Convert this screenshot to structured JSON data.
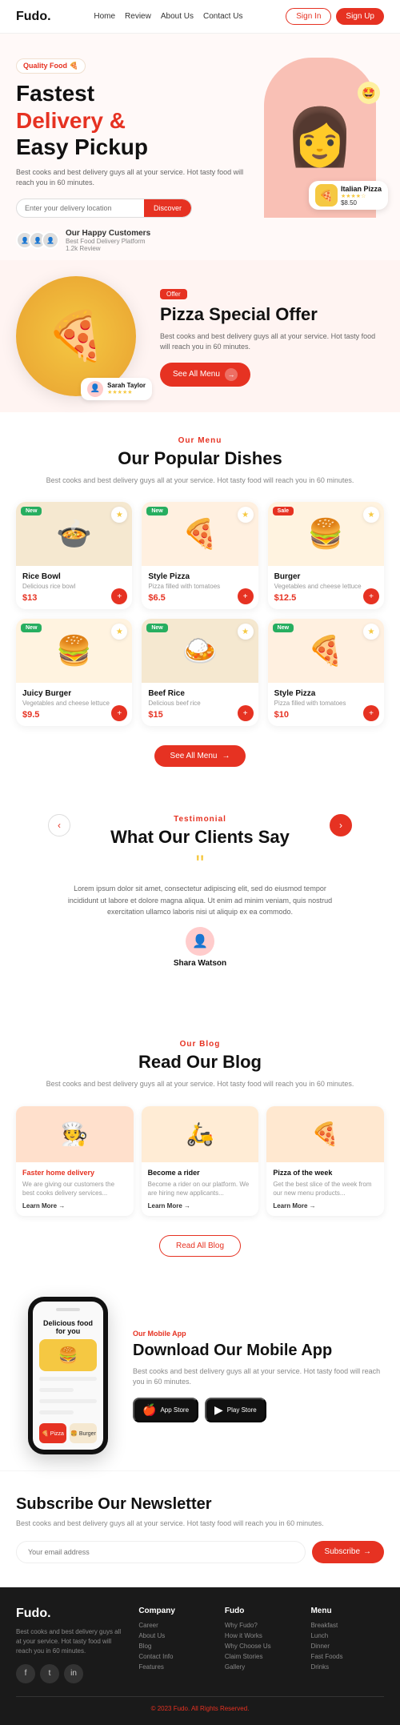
{
  "brand": "Fudo.",
  "nav": {
    "links": [
      "Home",
      "Review",
      "About Us",
      "Contact Us"
    ],
    "signin": "Sign In",
    "signup": "Sign Up"
  },
  "hero": {
    "badge": "Quality Food 🍕",
    "title_line1": "Fastest",
    "title_line2": "Delivery &",
    "title_line3": "Easy Pickup",
    "desc": "Best cooks and best delivery guys all at your service. Hot tasty food will reach you in 60 minutes.",
    "search_placeholder": "Enter your delivery location",
    "search_btn": "Discover",
    "customers": {
      "label": "Our Happy Customers",
      "sub": "Best Food Delivery Platform",
      "review_count": "1.2k Review"
    },
    "pizza_name": "Italian Pizza",
    "pizza_price": "$8.50",
    "emoji": "🤩"
  },
  "special_offer": {
    "tag": "Offer",
    "title": "Pizza Special Offer",
    "desc": "Best cooks and best delivery guys all at your service. Hot tasty food will reach you in 60 minutes.",
    "see_all": "See All Menu",
    "reviewer_name": "Sarah Taylor"
  },
  "popular": {
    "label": "Our Menu",
    "title": "Our Popular Dishes",
    "desc": "Best cooks and best delivery guys all at your service.\nHot tasty food will reach you in 60 minutes.",
    "see_all": "See All Menu",
    "dishes": [
      {
        "name": "Rice Bowl",
        "sub": "Delicious rice bowl",
        "price": "$13",
        "badge": "New",
        "emoji": "🍲",
        "bg": "rice"
      },
      {
        "name": "Style Pizza",
        "sub": "Pizza filled with tomatoes",
        "price": "$6.5",
        "badge": "New",
        "emoji": "🍕",
        "bg": "pizza"
      },
      {
        "name": "Burger",
        "sub": "Vegetables and cheese lettuce",
        "price": "$12.5",
        "badge": "Sale",
        "emoji": "🍔",
        "bg": "burger"
      },
      {
        "name": "Juicy Burger",
        "sub": "Vegetables and cheese lettuce",
        "price": "$9.5",
        "badge": "New",
        "emoji": "🍔",
        "bg": "burger"
      },
      {
        "name": "Beef Rice",
        "sub": "Delicious beef rice",
        "price": "$15",
        "badge": "New",
        "emoji": "🍛",
        "bg": "rice"
      },
      {
        "name": "Style Pizza",
        "sub": "Pizza filled with tomatoes",
        "price": "$10",
        "badge": "New",
        "emoji": "🍕",
        "bg": "pizza"
      }
    ]
  },
  "testimonials": {
    "label": "Testimonial",
    "title": "What Our Clients Say",
    "text": "Lorem ipsum dolor sit amet, consectetur adipiscing elit, sed do eiusmod tempor incididunt ut labore et dolore magna aliqua. Ut enim ad minim veniam, quis nostrud exercitation ullamco laboris nisi ut aliquip ex ea commodo.",
    "reviewer": "Shara Watson"
  },
  "blog": {
    "label": "Our Blog",
    "title": "Read Our Blog",
    "desc": "Best cooks and best delivery guys all at your service.\nHot tasty food will reach you in 60 minutes.",
    "posts": [
      {
        "title": "Faster home delivery",
        "desc": "We are giving our customers the best cooks delivery services...",
        "img": "🧑‍🍳",
        "bg": "1",
        "title_red": true
      },
      {
        "title": "Become a rider",
        "desc": "Become a rider on our platform. We are hiring new applicants...",
        "img": "🛵",
        "bg": "2",
        "title_red": false
      },
      {
        "title": "Pizza of the week",
        "desc": "Get the best slice of the week from our new menu products...",
        "img": "🍕",
        "bg": "3",
        "title_red": false
      }
    ],
    "learn_more": "Learn More →",
    "read_all": "Read All Blog"
  },
  "app": {
    "label": "Our Mobile App",
    "title": "Download Our Mobile App",
    "desc": "Best cooks and best delivery guys all at your service. Hot tasty food will reach you in 60 minutes.",
    "app_store": "App Store",
    "play_store": "Play Store",
    "phone_title": "Delicious food for you"
  },
  "newsletter": {
    "title": "Subscribe Our Newsletter",
    "desc": "Best cooks and best delivery guys all at your service. Hot tasty food will reach you in 60 minutes.",
    "placeholder": "Your email address",
    "btn": "Subscribe"
  },
  "footer": {
    "brand": "Fudo.",
    "desc": "Best cooks and best delivery guys all at your service. Hot tasty food will reach you in 60 minutes.",
    "socials": [
      "f",
      "t",
      "in"
    ],
    "columns": [
      {
        "heading": "Company",
        "links": [
          "Career",
          "About Us",
          "Blog",
          "Contact Info",
          "Features"
        ]
      },
      {
        "heading": "Fudo",
        "links": [
          "Why Fudo?",
          "How it Works",
          "Why Choose Us",
          "Claim Stories",
          "Gallery"
        ]
      },
      {
        "heading": "Menu",
        "links": [
          "Breakfast",
          "Lunch",
          "Dinner",
          "Fast Foods",
          "Drinks"
        ]
      }
    ],
    "copyright": "2023 Fudo. All Rights Reserved."
  }
}
